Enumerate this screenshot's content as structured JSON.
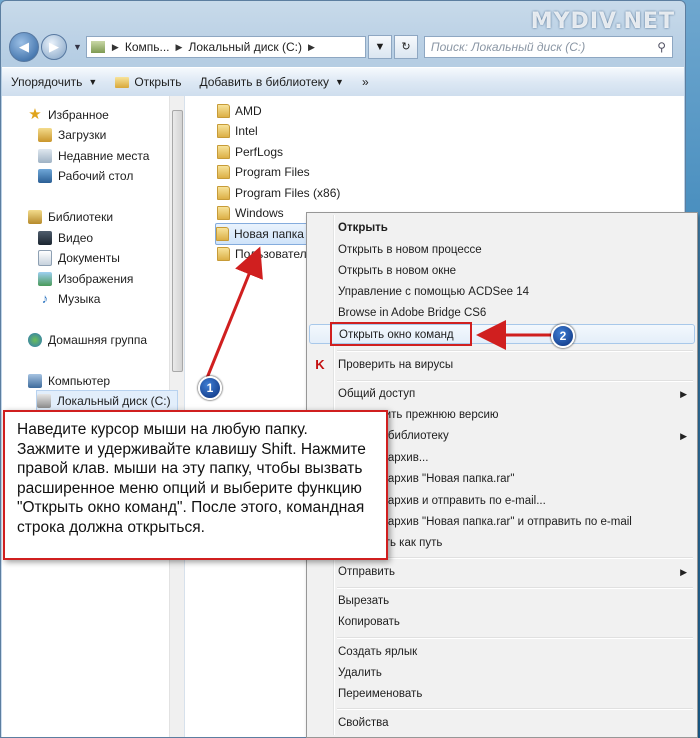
{
  "watermark": "MYDIV.NET",
  "window": {
    "min": "—",
    "max": "□",
    "close": "✕"
  },
  "nav": {
    "breadcrumb": [
      "Компь...",
      "Локальный диск (C:)"
    ],
    "search_placeholder": "Поиск: Локальный диск (C:)"
  },
  "toolbar": {
    "organize": "Упорядочить",
    "open": "Открыть",
    "add_library": "Добавить в библиотеку",
    "more": "»"
  },
  "sidebar": {
    "favorites": "Избранное",
    "downloads": "Загрузки",
    "recent": "Недавние места",
    "desktop": "Рабочий стол",
    "libraries": "Библиотеки",
    "video": "Видео",
    "documents": "Документы",
    "pictures": "Изображения",
    "music": "Музыка",
    "homegroup": "Домашняя группа",
    "computer": "Компьютер",
    "local_disk": "Локальный диск (C:)"
  },
  "files": [
    "AMD",
    "Intel",
    "PerfLogs",
    "Program Files",
    "Program Files (x86)",
    "Windows",
    "Новая папка",
    "Пользовател"
  ],
  "menu": {
    "open": "Открыть",
    "open_new_process": "Открыть в новом процессе",
    "open_new_window": "Открыть в новом окне",
    "acdsee": "Управление с помощью ACDSee 14",
    "bridge": "Browse in Adobe Bridge CS6",
    "open_cmd": "Открыть окно команд",
    "scan": "Проверить на вирусы",
    "share": "Общий доступ",
    "restore": "...вить прежнюю версию",
    "library": "...в библиотеку",
    "archive": "...в архив...",
    "archive_rar": "...в архив \"Новая папка.rar\"",
    "archive_email": "...в архив и отправить по e-mail...",
    "archive_rar_email": "...в архив \"Новая папка.rar\" и отправить по e-mail",
    "copy_path": "...ать как путь",
    "send_to": "Отправить",
    "cut": "Вырезать",
    "copy": "Копировать",
    "create_shortcut": "Создать ярлык",
    "delete": "Удалить",
    "rename": "Переименовать",
    "properties": "Свойства"
  },
  "annotation": {
    "text": "Наведите курсор мыши на любую папку. Зажмите и удерживайте клавишу Shift. Нажмите правой клав. мыши на эту папку, чтобы вызвать расширенное меню опций и выберите функцию \"Открыть окно команд\". После этого, командная строка должна открыться.",
    "badge1": "1",
    "badge2": "2"
  },
  "colors": {
    "accent": "#d01f1f",
    "badge": "#0b2f7a",
    "selection": "#cfe3f9"
  }
}
